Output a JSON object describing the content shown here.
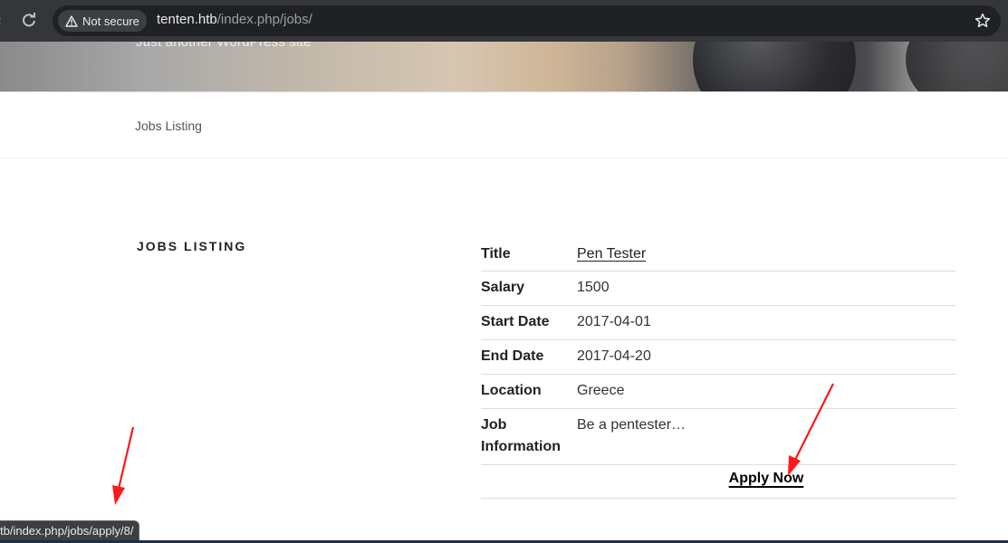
{
  "browser": {
    "security_label": "Not secure",
    "url_host": "tenten.htb",
    "url_path": "/index.php/jobs/",
    "status_url": "tb/index.php/jobs/apply/8/"
  },
  "site": {
    "tagline": "Just another WordPress site",
    "nav_item": "Jobs Listing"
  },
  "section": {
    "heading": "JOBS LISTING"
  },
  "job": {
    "title_label": "Title",
    "title_value": "Pen Tester",
    "salary_label": "Salary",
    "salary_value": "1500",
    "start_label": "Start Date",
    "start_value": "2017-04-01",
    "end_label": "End Date",
    "end_value": "2017-04-20",
    "location_label": "Location",
    "location_value": "Greece",
    "info_label_1": "Job",
    "info_label_2": "Information",
    "info_value": "Be a pentester…",
    "apply_label": "Apply Now"
  },
  "colors": {
    "annotation_arrow": "#ff1a1a",
    "chrome_bg": "#35363a"
  }
}
